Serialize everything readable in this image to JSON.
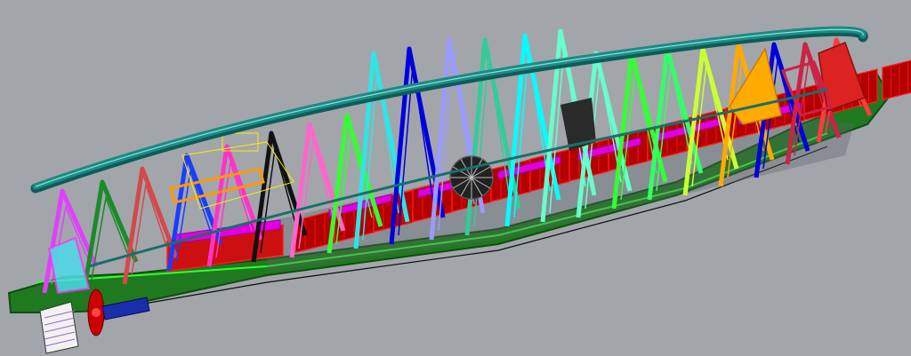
{
  "viewport": {
    "background": "#a2a6ab"
  },
  "model": {
    "palette": {
      "keel": "#1f7a1f",
      "gunwale": "#1f8a84",
      "battery": "#b30000",
      "battery_edge": "#ff1a1a",
      "frames": [
        "#e040fb",
        "#1b8a2a",
        "#d24a4a",
        "#1a3dff",
        "#ff33cc",
        "#ff66cc",
        "#111111",
        "#ff40ff",
        "#33ff33",
        "#2ee6e6",
        "#0000dd",
        "#9a9aff",
        "#33cc99",
        "#00ffff",
        "#66ffcc",
        "#ccff33",
        "#33ff66",
        "#ffaa00",
        "#cc2244",
        "#ff3b3b"
      ],
      "outline_green": "#33ff33",
      "magenta_plate": "#e000e0",
      "orange_part": "#ff9900",
      "yellow_part": "#ffee00",
      "propeller": "#cc0000",
      "motor": "#222222"
    },
    "components": [
      "keel-beam",
      "gunwale-rail",
      "battery-pack",
      "frame-rib",
      "propeller",
      "rudder",
      "motor-hub",
      "bow-frames"
    ]
  }
}
